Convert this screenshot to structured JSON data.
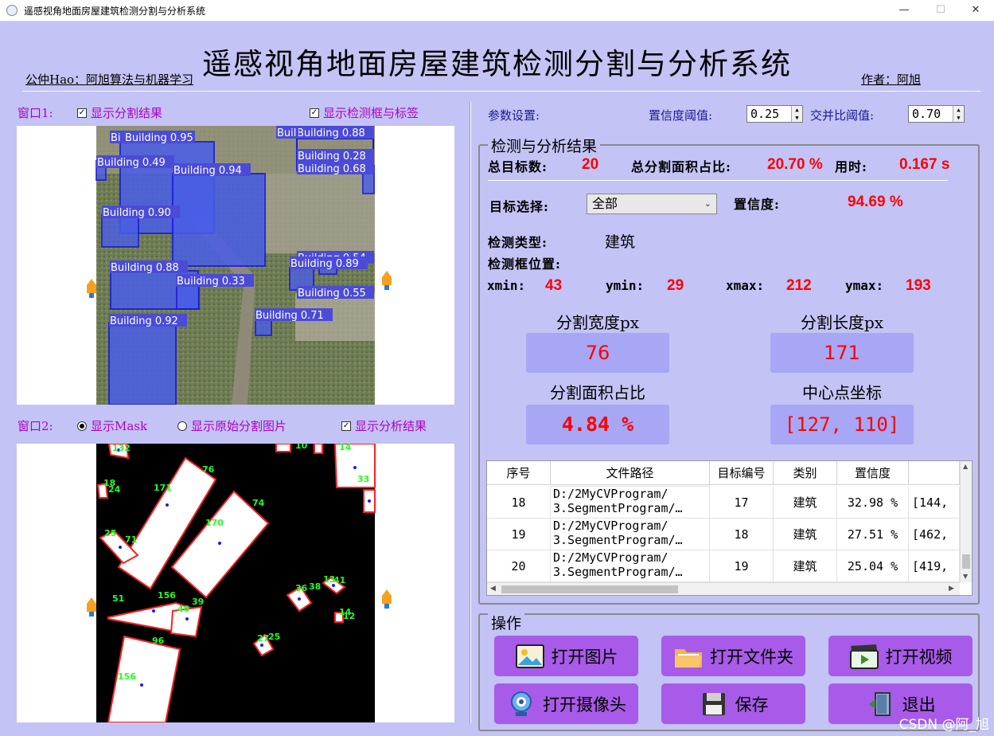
{
  "window": {
    "title": "遥感视角地面房屋建筑检测分割与分析系统",
    "controls": [
      "—",
      "☐",
      "✕"
    ]
  },
  "header": {
    "title": "遥感视角地面房屋建筑检测分割与分析系统",
    "left_note": "公仲Hao：阿旭算法与机器学习",
    "right_note": "作者：阿旭"
  },
  "window1": {
    "label": "窗口1:",
    "show_seg": "显示分割结果",
    "show_boxes": "显示检测框与标签",
    "detections": [
      {
        "label": "Building 0.95"
      },
      {
        "label": "Bi"
      },
      {
        "label": "Building 0.49"
      },
      {
        "label": "Building 0.94"
      },
      {
        "label": "Building 0.90"
      },
      {
        "label": "Building 0.88"
      },
      {
        "label": "Building 0.33"
      },
      {
        "label": "Building 0.92"
      },
      {
        "label": "Building 0.71"
      },
      {
        "label": "Building 0.88"
      },
      {
        "label": "Buil"
      },
      {
        "label": "Building 0.28"
      },
      {
        "label": "Building 0.68"
      },
      {
        "label": "Building 0.54"
      },
      {
        "label": "Building 0.89"
      },
      {
        "label": "Building 0.55"
      }
    ]
  },
  "window2": {
    "label": "窗口2:",
    "radio_mask": "显示Mask",
    "radio_orig": "显示原始分割图片",
    "show_analysis": "显示分析结果",
    "mask_labels": [
      "132",
      "76",
      "171",
      "18",
      "24",
      "74",
      "170",
      "25",
      "71",
      "156",
      "39",
      "40",
      "51",
      "96",
      "156",
      "36",
      "38",
      "13",
      "41",
      "14",
      "12",
      "25",
      "27",
      "10",
      "14",
      "33"
    ]
  },
  "params": {
    "label": "参数设置:",
    "conf_label": "置信度阈值:",
    "conf_value": "0.25",
    "iou_label": "交并比阈值:",
    "iou_value": "0.70"
  },
  "results": {
    "title": "检测与分析结果",
    "total_label": "总目标数:",
    "total_value": "20",
    "area_label": "总分割面积占比:",
    "area_value": "20.70 %",
    "time_label": "用时:",
    "time_value": "0.167 s",
    "target_label": "目标选择:",
    "target_value": "全部",
    "conf_label": "置信度:",
    "conf_value": "94.69 %",
    "type_label": "检测类型:",
    "type_value": "建筑",
    "pos_label": "检测框位置:",
    "xmin_label": "xmin:",
    "xmin_value": "43",
    "ymin_label": "ymin:",
    "ymin_value": "29",
    "xmax_label": "xmax:",
    "xmax_value": "212",
    "ymax_label": "ymax:",
    "ymax_value": "193",
    "seg_width_label": "分割宽度px",
    "seg_width_value": "76",
    "seg_length_label": "分割长度px",
    "seg_length_value": "171",
    "seg_ratio_label": "分割面积占比",
    "seg_ratio_value": "4.84 %",
    "center_label": "中心点坐标",
    "center_value": "[127, 110]"
  },
  "table": {
    "headers": [
      "序号",
      "文件路径",
      "目标编号",
      "类别",
      "置信度",
      ""
    ],
    "partial_row": "D:/2MyCVProgram/",
    "rows": [
      {
        "idx": "18",
        "path1": "D:/2MyCVProgram/",
        "path2": "3.SegmentProgram/…",
        "obj": "17",
        "cls": "建筑",
        "conf": "32.98 %",
        "pos": "[144,"
      },
      {
        "idx": "19",
        "path1": "D:/2MyCVProgram/",
        "path2": "3.SegmentProgram/…",
        "obj": "18",
        "cls": "建筑",
        "conf": "27.51 %",
        "pos": "[462,"
      },
      {
        "idx": "20",
        "path1": "D:/2MyCVProgram/",
        "path2": "3.SegmentProgram/…",
        "obj": "19",
        "cls": "建筑",
        "conf": "25.04 %",
        "pos": "[419,"
      }
    ]
  },
  "ops": {
    "title": "操作",
    "open_image": "打开图片",
    "open_folder": "打开文件夹",
    "open_video": "打开视频",
    "open_camera": "打开摄像头",
    "save": "保存",
    "exit": "退出"
  },
  "watermark": "CSDN @阿_旭",
  "colors": {
    "background": "#c3c3f5",
    "button": "#a75be8",
    "value_red": "#ff0000",
    "label_purple": "#b000c8"
  }
}
